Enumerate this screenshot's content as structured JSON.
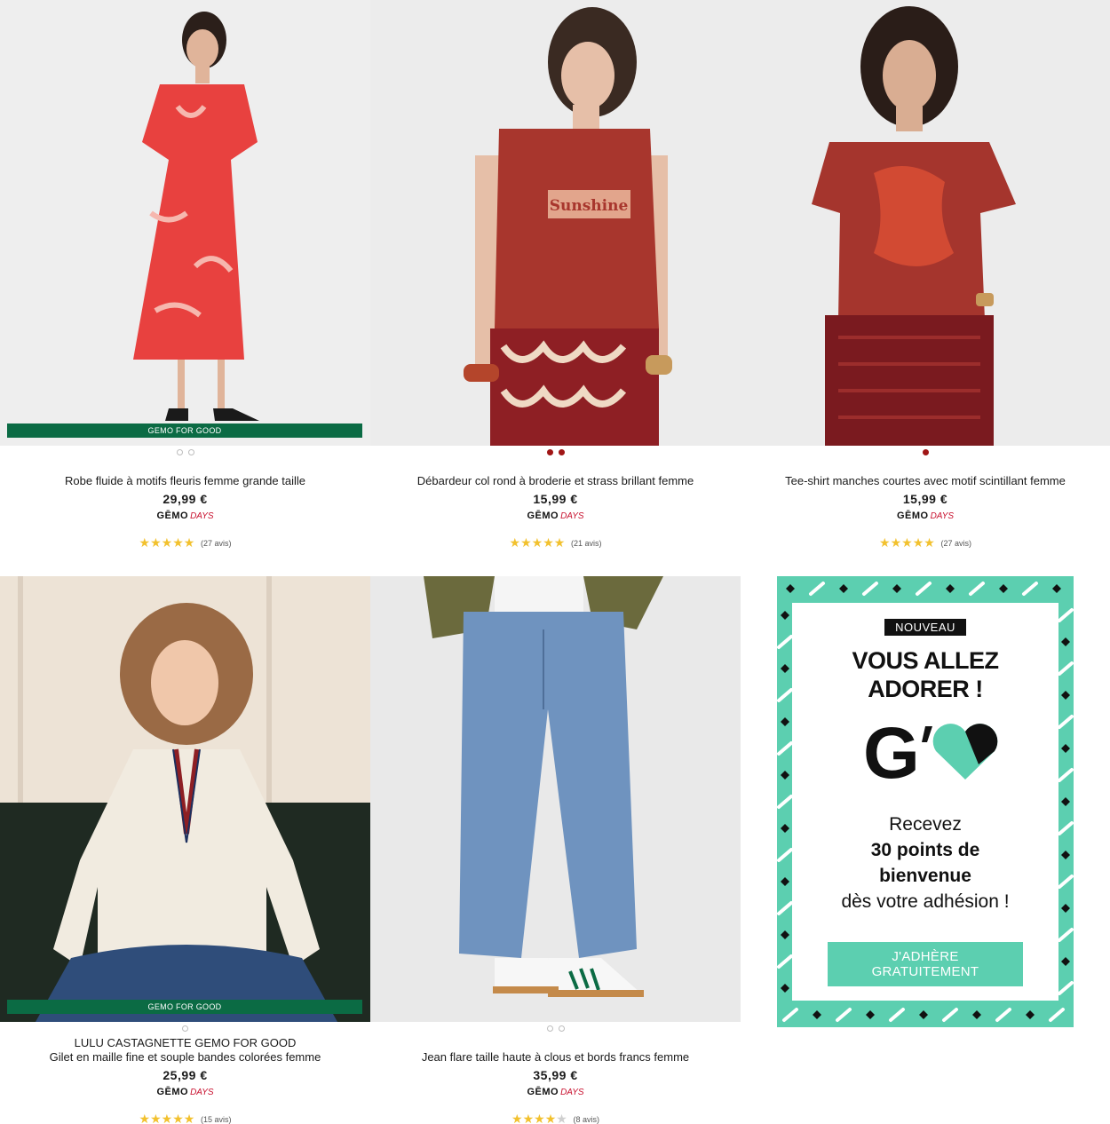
{
  "products": [
    {
      "name": "Robe fluide à motifs fleuris femme grande taille",
      "price": "29,99 €",
      "badge": "GEMO FOR GOOD",
      "logo_gemo": "GĒMO",
      "logo_days": "DAYS",
      "rating": 5,
      "reviews": "(27 avis)",
      "colors": {
        "bg": "#eeeeee",
        "garment": "#e8413f"
      }
    },
    {
      "name": "Débardeur col rond à broderie et strass brillant femme",
      "price": "15,99 €",
      "print": "Sunshine",
      "logo_gemo": "GĒMO",
      "logo_days": "DAYS",
      "rating": 4.5,
      "reviews": "(21 avis)",
      "colors": {
        "bg": "#ececec",
        "garment": "#a8362d"
      }
    },
    {
      "name": "Tee-shirt manches courtes avec motif scintillant femme",
      "price": "15,99 €",
      "logo_gemo": "GĒMO",
      "logo_days": "DAYS",
      "rating": 4.5,
      "reviews": "(27 avis)",
      "colors": {
        "bg": "#ececec",
        "garment": "#a5352d"
      }
    },
    {
      "brand": "LULU CASTAGNETTE GEMO FOR GOOD",
      "name": "Gilet en maille fine et souple bandes colorées femme",
      "price": "25,99 €",
      "badge": "GEMO FOR GOOD",
      "logo_gemo": "GĒMO",
      "logo_days": "DAYS",
      "rating": 5,
      "reviews": "(15 avis)",
      "colors": {
        "bg": "#e7dccf",
        "garment": "#f1ebe0"
      }
    },
    {
      "name": "Jean flare taille haute à clous et bords francs femme",
      "price": "35,99 €",
      "logo_gemo": "GĒMO",
      "logo_days": "DAYS",
      "rating": 4,
      "reviews": "(8 avis)",
      "colors": {
        "bg": "#e9e9e9",
        "garment": "#6f93bf"
      }
    }
  ],
  "promo": {
    "tag": "NOUVEAU",
    "headline_1": "VOUS ALLEZ",
    "headline_2": "ADORER !",
    "logo_letter": "G",
    "line_1": "Recevez",
    "line_2": "30 points de",
    "line_3": "bienvenue",
    "line_4": "dès votre adhésion !",
    "cta": "J'ADHÈRE GRATUITEMENT",
    "colors": {
      "accent": "#5ccfb0",
      "dark": "#111111"
    }
  }
}
